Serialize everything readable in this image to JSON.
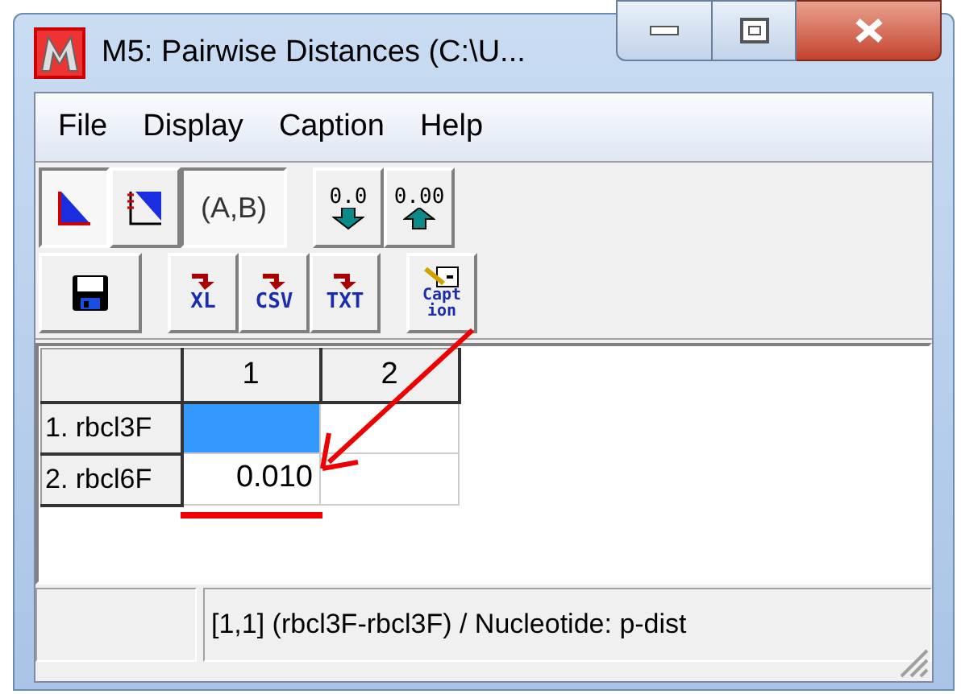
{
  "window": {
    "title": "M5: Pairwise Distances (C:\\U..."
  },
  "menu": [
    {
      "label": "File"
    },
    {
      "label": "Display"
    },
    {
      "label": "Caption"
    },
    {
      "label": "Help"
    }
  ],
  "toolbar_rows": [
    [
      {
        "kind": "lower",
        "pressed": true
      },
      {
        "kind": "upper",
        "pressed": false
      },
      {
        "kind": "pair",
        "label": "(A,B)",
        "pressed": true
      },
      {
        "kind": "down",
        "label": "0.0",
        "pressed": false
      },
      {
        "kind": "up",
        "label": "0.00",
        "pressed": false
      }
    ],
    [
      {
        "kind": "save",
        "pressed": false
      },
      {
        "kind": "export",
        "label": "XL",
        "pressed": false
      },
      {
        "kind": "export",
        "label": "CSV",
        "pressed": false
      },
      {
        "kind": "export",
        "label": "TXT",
        "pressed": false
      },
      {
        "kind": "caption",
        "lines": [
          "Capt",
          "ion"
        ],
        "pressed": false
      }
    ]
  ],
  "grid": {
    "columns": [
      "1",
      "2"
    ],
    "rows": [
      {
        "label": "1. rbcl3F",
        "cells": [
          {
            "selected": true
          },
          {
            "selected": false
          }
        ]
      },
      {
        "label": "2. rbcl6F",
        "cells": [
          {
            "value": "0.010",
            "selected": false
          },
          {
            "selected": false
          }
        ]
      }
    ]
  },
  "status_bar": {
    "text": "[1,1] (rbcl3F-rbcl3F) / Nucleotide: p-dist"
  }
}
